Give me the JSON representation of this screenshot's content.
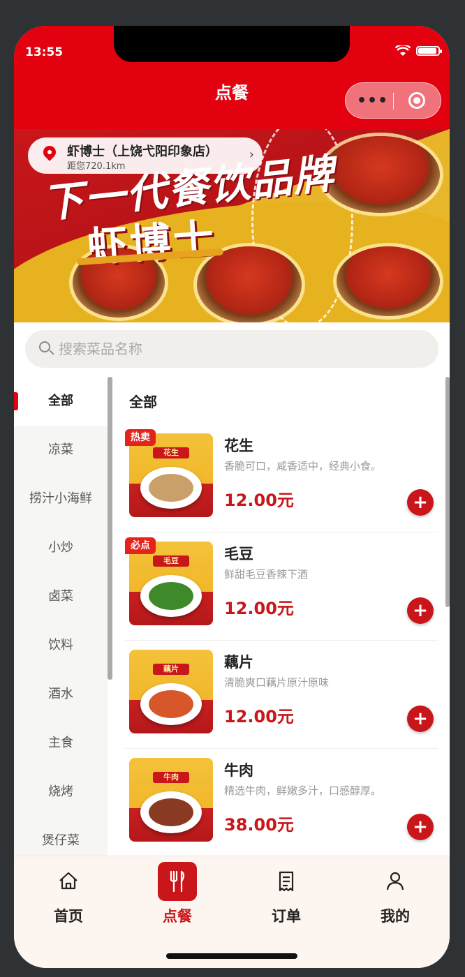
{
  "status_bar": {
    "time": "13:55",
    "battery_level": 0.92
  },
  "header": {
    "title": "点餐"
  },
  "banner": {
    "slogan": "下一代餐饮品牌",
    "brand": "虾博士",
    "location": {
      "name": "虾博士（上饶弋阳印象店）",
      "distance": "距您720.1km"
    }
  },
  "search": {
    "placeholder": "搜索菜品名称",
    "value": ""
  },
  "sidebar": {
    "categories": [
      {
        "label": "全部",
        "active": true
      },
      {
        "label": "凉菜"
      },
      {
        "label": "捞汁小海鲜"
      },
      {
        "label": "小炒"
      },
      {
        "label": "卤菜"
      },
      {
        "label": "饮料"
      },
      {
        "label": "酒水"
      },
      {
        "label": "主食"
      },
      {
        "label": "烧烤"
      },
      {
        "label": "煲仔菜"
      }
    ]
  },
  "main": {
    "section_title": "全部",
    "items": [
      {
        "tag": "热卖",
        "name": "花生",
        "thumb_label": "花生",
        "desc": "香脆可口，咸香适中，经典小食。",
        "price": "12.00元"
      },
      {
        "tag": "必点",
        "name": "毛豆",
        "thumb_label": "毛豆",
        "desc": "鲜甜毛豆香辣下酒",
        "price": "12.00元"
      },
      {
        "tag": "",
        "name": "藕片",
        "thumb_label": "藕片",
        "desc": "清脆爽口藕片原汁原味",
        "price": "12.00元"
      },
      {
        "tag": "",
        "name": "牛肉",
        "thumb_label": "牛肉",
        "desc": "精选牛肉，鲜嫩多汁，口感醇厚。",
        "price": "38.00元"
      }
    ],
    "add_symbol": "+"
  },
  "tabbar": {
    "tabs": [
      {
        "label": "首页",
        "icon": "home-icon"
      },
      {
        "label": "点餐",
        "icon": "fork-knife-icon",
        "active": true
      },
      {
        "label": "订单",
        "icon": "receipt-icon"
      },
      {
        "label": "我的",
        "icon": "user-icon"
      }
    ]
  },
  "colors": {
    "brand_red": "#e3000f",
    "price_red": "#c8161a",
    "tabbar_bg": "#fdf5f0"
  }
}
